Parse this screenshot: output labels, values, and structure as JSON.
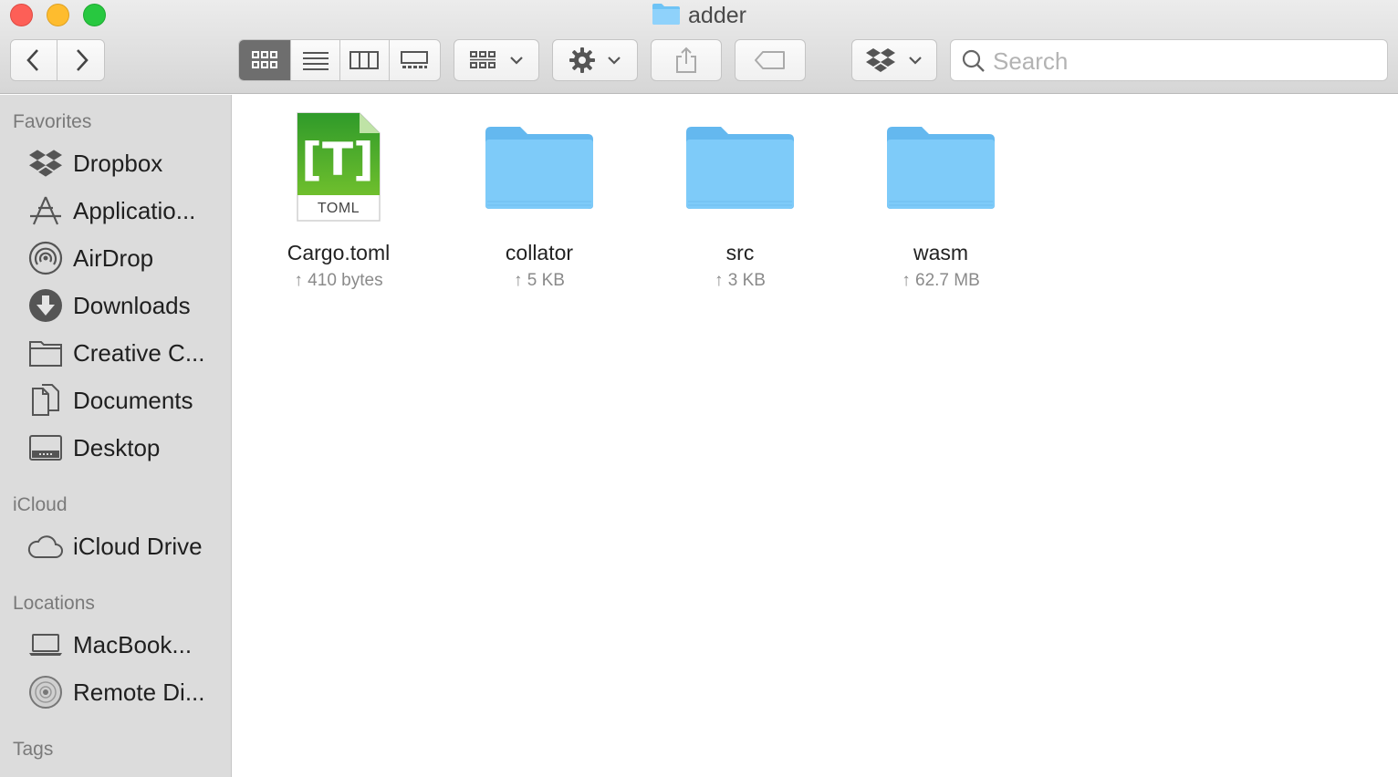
{
  "window": {
    "title": "adder",
    "colors": {
      "close": "#fd5f57",
      "minimize": "#febc2e",
      "maximize": "#28c840"
    }
  },
  "toolbar": {
    "back_icon": "chevron-left-icon",
    "forward_icon": "chevron-right-icon",
    "view_modes": [
      "icon-view",
      "list-view",
      "column-view",
      "gallery-view"
    ],
    "active_view": "icon-view",
    "search_placeholder": "Search"
  },
  "sidebar": {
    "sections": [
      {
        "title": "Favorites",
        "items": [
          {
            "label": "Dropbox",
            "icon": "dropbox-icon"
          },
          {
            "label": "Applicatio...",
            "icon": "applications-icon"
          },
          {
            "label": "AirDrop",
            "icon": "airdrop-icon"
          },
          {
            "label": "Downloads",
            "icon": "downloads-icon"
          },
          {
            "label": "Creative C...",
            "icon": "folder-icon"
          },
          {
            "label": "Documents",
            "icon": "documents-icon"
          },
          {
            "label": "Desktop",
            "icon": "desktop-icon"
          }
        ]
      },
      {
        "title": "iCloud",
        "items": [
          {
            "label": "iCloud Drive",
            "icon": "cloud-icon"
          }
        ]
      },
      {
        "title": "Locations",
        "items": [
          {
            "label": "MacBook...",
            "icon": "laptop-icon"
          },
          {
            "label": "Remote Di...",
            "icon": "disc-icon"
          }
        ]
      },
      {
        "title": "Tags",
        "items": []
      }
    ]
  },
  "files": [
    {
      "name": "Cargo.toml",
      "meta": "↑ 410 bytes",
      "kind": "toml-file",
      "badge": "TOML",
      "glyph": "[T]"
    },
    {
      "name": "collator",
      "meta": "↑ 5 KB",
      "kind": "folder"
    },
    {
      "name": "src",
      "meta": "↑ 3 KB",
      "kind": "folder"
    },
    {
      "name": "wasm",
      "meta": "↑ 62.7 MB",
      "kind": "folder"
    }
  ]
}
